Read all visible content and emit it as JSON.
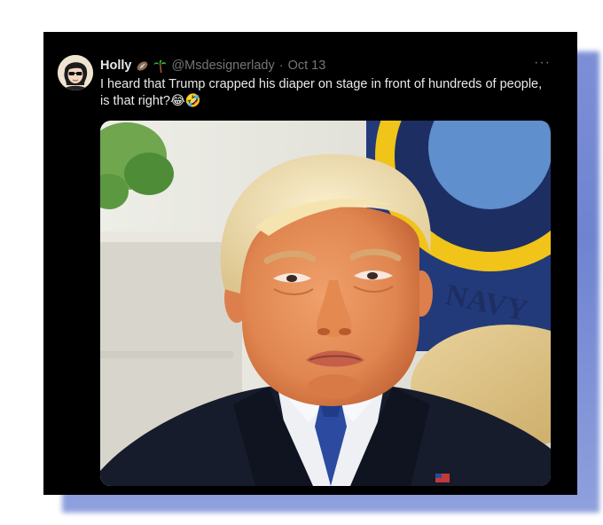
{
  "tweet": {
    "author_name": "Holly",
    "handle": "@Msdesignerlady",
    "separator": "·",
    "date": "Oct 13",
    "more_label": "···",
    "text": "I heard that Trump crapped his diaper on stage in front of hundreds of people, is that right?😂🤣",
    "name_badges": [
      "football-emoji-icon",
      "palm-tree-emoji-icon"
    ]
  },
  "media": {
    "description_icon": "photo-of-man-pouting",
    "seal_text": "NAVY"
  },
  "colors": {
    "card_background": "#000000",
    "primary_text": "#e7e9ea",
    "secondary_text": "#71767b",
    "frame_shadow": "#7d8fd6"
  }
}
